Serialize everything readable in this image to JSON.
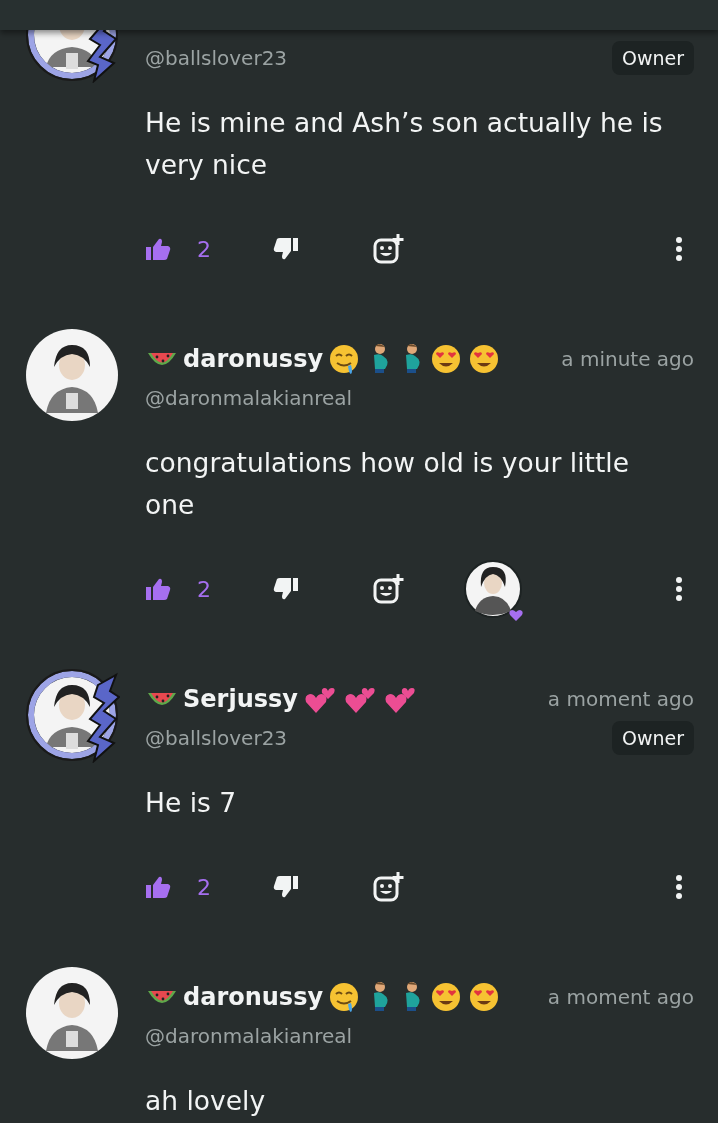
{
  "comments": [
    {
      "avatar_frame": true,
      "handle": "@ballslover23",
      "badge": "Owner",
      "text": "He is mine and Ash’s son actually he is very nice",
      "likes": "2",
      "liked": true
    },
    {
      "avatar_frame": false,
      "emojis_before": [
        {
          "kind": "watermelon"
        }
      ],
      "name": "daronussy",
      "emojis_after": [
        {
          "kind": "drooling"
        },
        {
          "kind": "pregnant-man"
        },
        {
          "kind": "pregnant-man"
        },
        {
          "kind": "heart-eyes"
        },
        {
          "kind": "heart-eyes"
        }
      ],
      "time": "a minute ago",
      "handle": "@daronmalakianreal",
      "text": "congratulations how old is your little one",
      "likes": "2",
      "liked": true,
      "reactions": [
        {
          "kind": "heart"
        }
      ]
    },
    {
      "avatar_frame": true,
      "emojis_before": [
        {
          "kind": "watermelon"
        }
      ],
      "name": "Serjussy",
      "emojis_after": [
        {
          "kind": "two-hearts"
        },
        {
          "kind": "two-hearts"
        },
        {
          "kind": "two-hearts"
        }
      ],
      "time": "a moment ago",
      "handle": "@ballslover23",
      "badge": "Owner",
      "text": "He is 7",
      "likes": "2",
      "liked": true
    },
    {
      "avatar_frame": false,
      "emojis_before": [
        {
          "kind": "watermelon"
        }
      ],
      "name": "daronussy",
      "emojis_after": [
        {
          "kind": "drooling"
        },
        {
          "kind": "pregnant-man"
        },
        {
          "kind": "pregnant-man"
        },
        {
          "kind": "heart-eyes"
        },
        {
          "kind": "heart-eyes"
        }
      ],
      "time": "a moment ago",
      "handle": "@daronmalakianreal",
      "text": "ah lovely"
    }
  ]
}
